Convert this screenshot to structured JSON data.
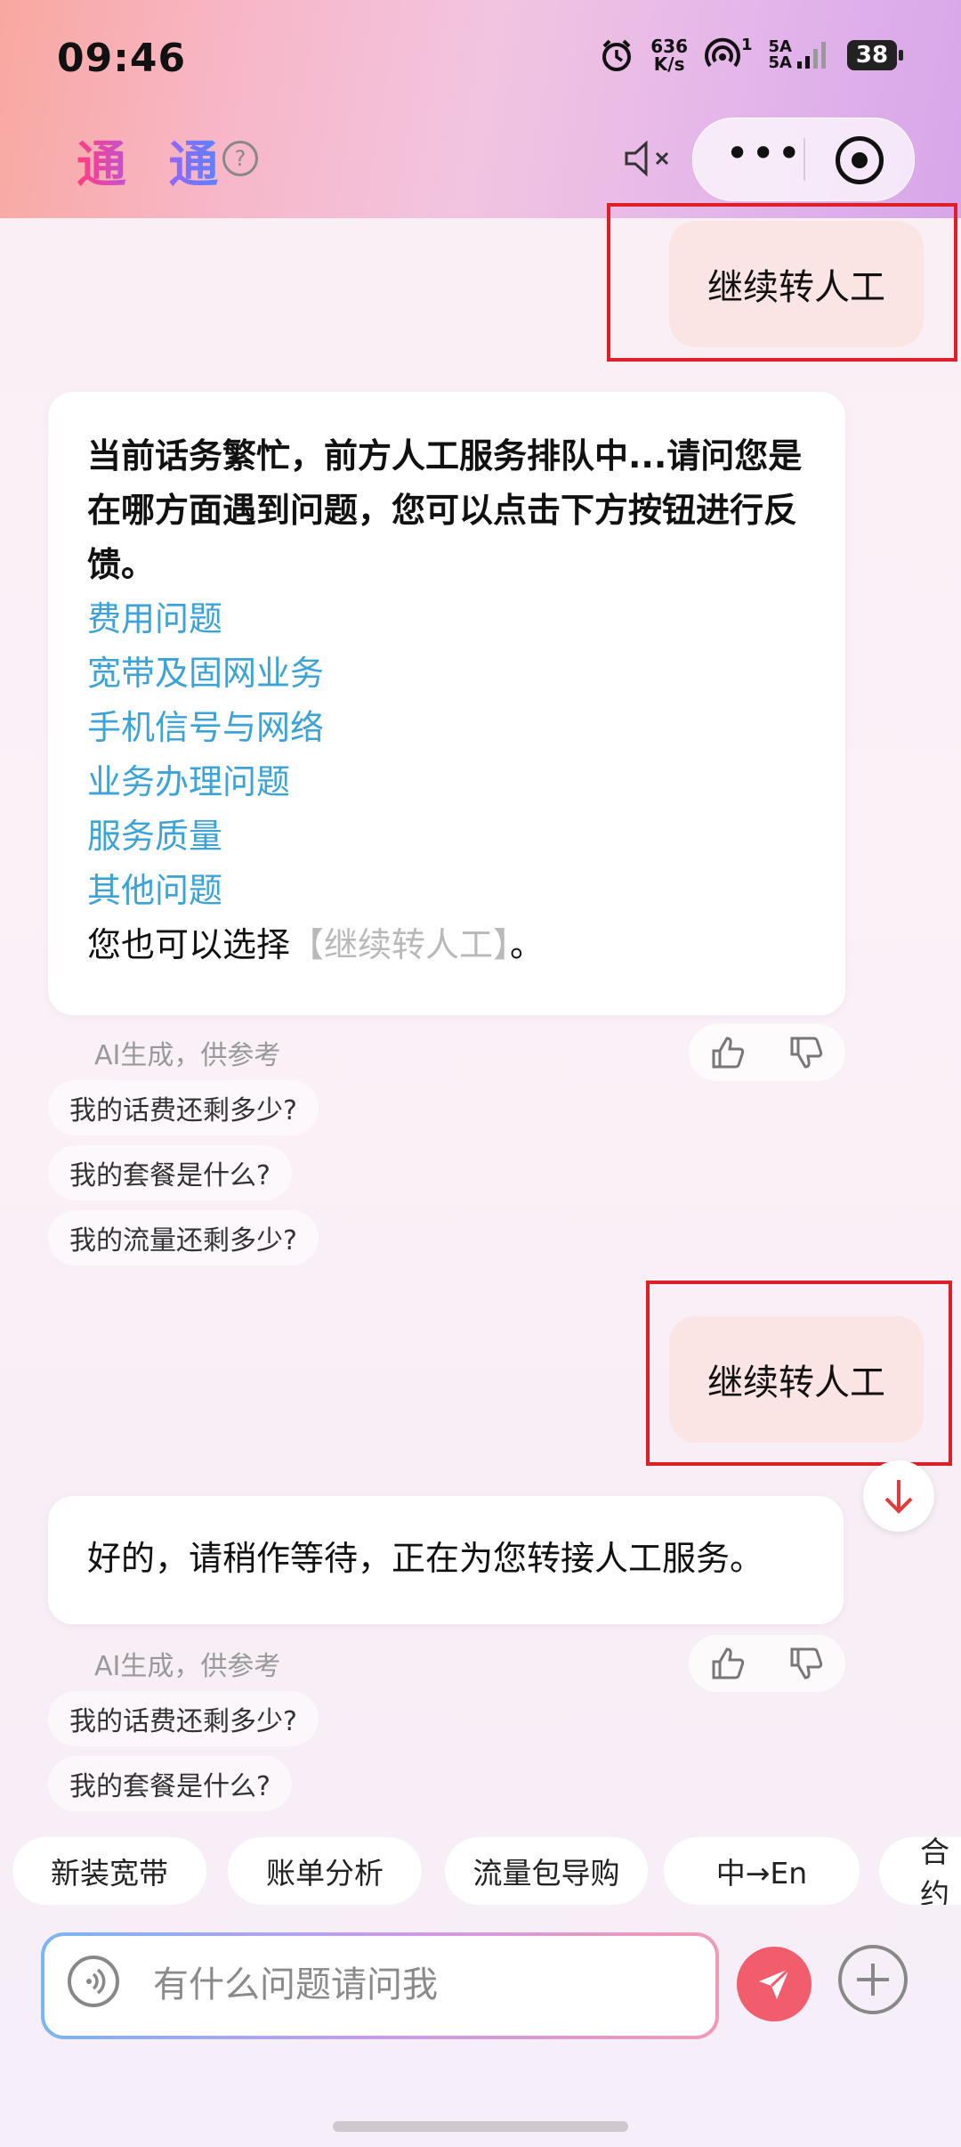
{
  "status_bar": {
    "time": "09:46",
    "net_speed_value": "636",
    "net_speed_unit": "K/s",
    "hotspot_count": "1",
    "sim1": "5A",
    "sim2": "5A",
    "battery": "38"
  },
  "header": {
    "title": "通 通",
    "help": "?",
    "more_icon": "more-dots-icon",
    "target_icon": "target-icon"
  },
  "messages": {
    "user1": "继续转人工",
    "bot1": {
      "intro": "当前话务繁忙，前方人工服务排队中...请问您是在哪方面遇到问题，您可以点击下方按钮进行反馈。",
      "options": [
        "费用问题",
        "宽带及固网业务",
        "手机信号与网络",
        "业务办理问题",
        "服务质量",
        "其他问题"
      ],
      "outro_prefix": "您也可以选择",
      "outro_link": "【继续转人工】",
      "outro_suffix": "。"
    },
    "ai_note": "AI生成，供参考",
    "suggestions1": [
      "我的话费还剩多少?",
      "我的套餐是什么?",
      "我的流量还剩多少?"
    ],
    "user2": "继续转人工",
    "bot2": "好的，请稍作等待，正在为您转接人工服务。",
    "suggestions2": [
      "我的话费还剩多少?",
      "我的套餐是什么?"
    ]
  },
  "quick_chips": [
    "新装宽带",
    "账单分析",
    "流量包导购",
    "中→En",
    "合约"
  ],
  "input": {
    "placeholder": "有什么问题请问我"
  },
  "colors": {
    "highlight_box": "#e01e26",
    "link": "#3ba3d8",
    "send_button": "#f15d6c",
    "user_bubble": "#fbe5e4"
  }
}
